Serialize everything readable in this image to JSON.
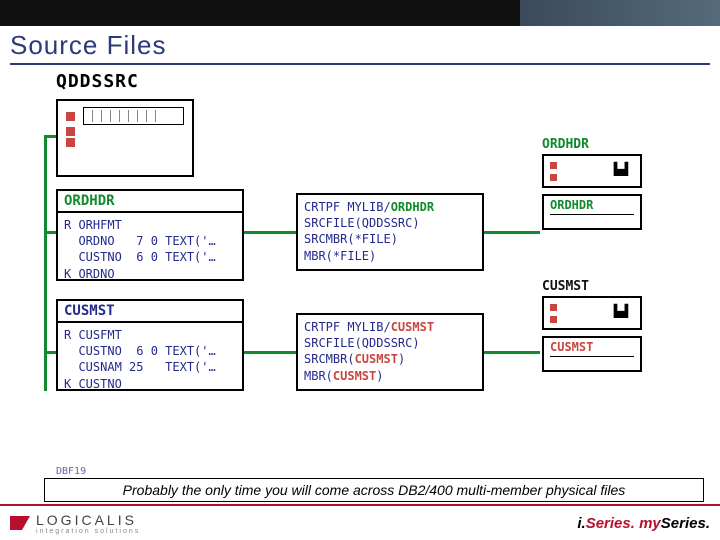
{
  "slide": {
    "title": "Source Files",
    "code": "DBF19",
    "caption": "Probably the only time you will come across DB2/400 multi-member physical files"
  },
  "sourceFile": {
    "name": "QDDSSRC"
  },
  "members": {
    "ordhdr": {
      "name": "ORDHDR",
      "lines": [
        "R ORHFMT",
        "  ORDNO   7 0 TEXT('…",
        "  CUSTNO  6 0 TEXT('…",
        "K ORDNO"
      ]
    },
    "cusmst": {
      "name": "CUSMST",
      "lines": [
        "R CUSFMT",
        "  CUSTNO  6 0 TEXT('…",
        "  CUSNAM 25   TEXT('…",
        "K CUSTNO"
      ]
    }
  },
  "commands": {
    "ordhdr": {
      "linesPre": [
        "CRTPF MYLIB/",
        "SRCFILE(QDDSSRC)",
        "SRCMBR(*FILE)",
        "MBR(*FILE)"
      ],
      "objName": "ORDHDR",
      "objClass": "obj"
    },
    "cusmst": {
      "linesPre": [
        "CRTPF MYLIB/",
        "SRCFILE(QDDSSRC)",
        "SRCMBR(",
        "MBR("
      ],
      "objName": "CUSMST",
      "objClass": "obj-red"
    }
  },
  "outputs": {
    "ordhdr": {
      "title": "ORDHDR",
      "member": "ORDHDR",
      "color": "#128a2e"
    },
    "cusmst": {
      "title": "CUSMST",
      "member": "CUSMST",
      "color": "#c9453f"
    }
  },
  "footer": {
    "brand": "LOGICALIS",
    "tagline": "integration solutions",
    "right1a": "i.",
    "right1b": "Series.",
    "right2a": "my",
    "right2b": "Series."
  }
}
